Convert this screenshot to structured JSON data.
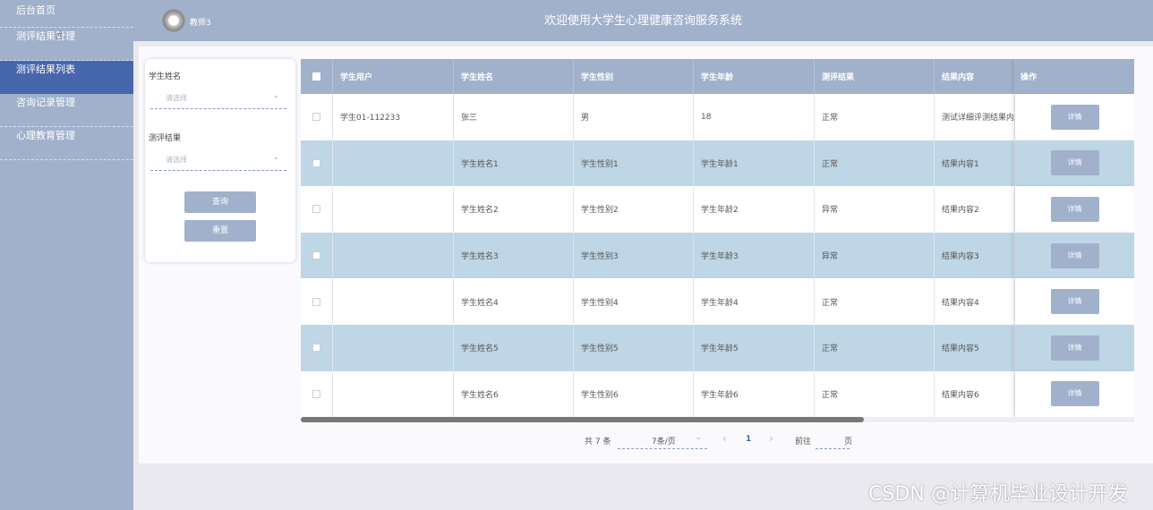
{
  "sidebar": {
    "items": [
      {
        "label": "后台首页"
      },
      {
        "label": "测评结果管理"
      },
      {
        "label": "测评结果列表"
      },
      {
        "label": "咨询记录管理"
      },
      {
        "label": "心理教育管理"
      }
    ]
  },
  "header": {
    "user": "教师3",
    "title": "欢迎使用大学生心理健康咨询服务系统"
  },
  "filter": {
    "student_name_label": "学生姓名",
    "student_name_placeholder": "请选择",
    "result_label": "测评结果",
    "result_placeholder": "请选择",
    "query_button": "查询",
    "reset_button": "重置"
  },
  "table": {
    "columns": [
      "学生用户",
      "学生姓名",
      "学生性别",
      "学生年龄",
      "测评结果",
      "结果内容",
      "操作"
    ],
    "rows": [
      {
        "user": "学生01-112233",
        "name": "张三",
        "gender": "男",
        "age": "18",
        "result": "正常",
        "content": "测试详细评测结果内",
        "action": "详情"
      },
      {
        "user": "",
        "name": "学生姓名1",
        "gender": "学生性别1",
        "age": "学生年龄1",
        "result": "正常",
        "content": "结果内容1",
        "action": "详情"
      },
      {
        "user": "",
        "name": "学生姓名2",
        "gender": "学生性别2",
        "age": "学生年龄2",
        "result": "异常",
        "content": "结果内容2",
        "action": "详情"
      },
      {
        "user": "",
        "name": "学生姓名3",
        "gender": "学生性别3",
        "age": "学生年龄3",
        "result": "异常",
        "content": "结果内容3",
        "action": "详情"
      },
      {
        "user": "",
        "name": "学生姓名4",
        "gender": "学生性别4",
        "age": "学生年龄4",
        "result": "正常",
        "content": "结果内容4",
        "action": "详情"
      },
      {
        "user": "",
        "name": "学生姓名5",
        "gender": "学生性别5",
        "age": "学生年龄5",
        "result": "正常",
        "content": "结果内容5",
        "action": "详情"
      },
      {
        "user": "",
        "name": "学生姓名6",
        "gender": "学生性别6",
        "age": "学生年龄6",
        "result": "正常",
        "content": "结果内容6",
        "action": "详情"
      }
    ]
  },
  "pagination": {
    "total": "共 7 条",
    "page_size": "7条/页",
    "prev": "‹",
    "current": "1",
    "next": "›",
    "goto_label": "前往",
    "page_suffix": "页"
  },
  "watermark": "CSDN @计算机毕业设计开发",
  "colors": {
    "sidebar": "#a1b1cc",
    "active": "#4767ad",
    "row_even": "#bed6e5"
  }
}
